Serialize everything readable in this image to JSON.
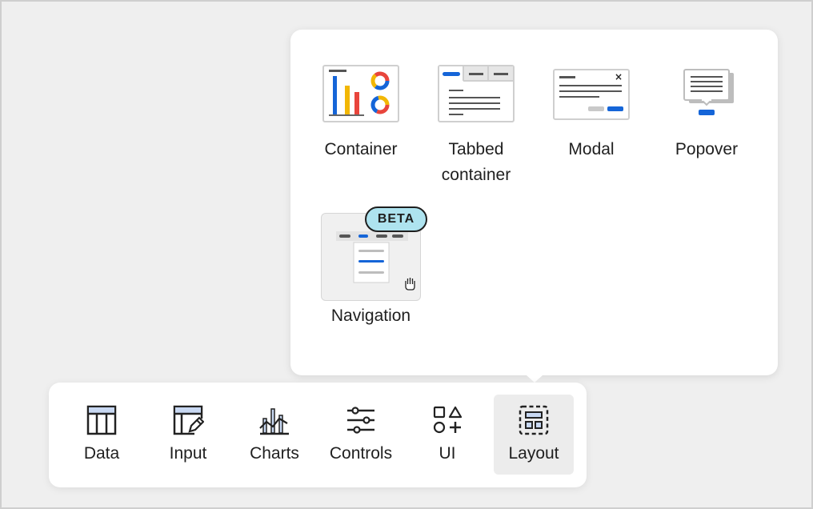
{
  "popover": {
    "items": [
      {
        "label": "Container",
        "icon": "container-icon"
      },
      {
        "label": "Tabbed\ncontainer",
        "icon": "tabbed-container-icon"
      },
      {
        "label": "Modal",
        "icon": "modal-icon"
      },
      {
        "label": "Popover",
        "icon": "popover-icon"
      }
    ],
    "navigation": {
      "label": "Navigation",
      "badge": "BETA",
      "icon": "navigation-icon"
    }
  },
  "toolbar": {
    "items": [
      {
        "label": "Data",
        "icon": "table-icon"
      },
      {
        "label": "Input",
        "icon": "input-icon"
      },
      {
        "label": "Charts",
        "icon": "charts-icon"
      },
      {
        "label": "Controls",
        "icon": "sliders-icon"
      },
      {
        "label": "UI",
        "icon": "shapes-icon"
      },
      {
        "label": "Layout",
        "icon": "layout-icon"
      }
    ],
    "active": "Layout"
  },
  "colors": {
    "accent_blue": "#1565d8",
    "bar_red": "#e8453c",
    "bar_yellow": "#f2b705",
    "badge_bg": "#aee3ef"
  }
}
